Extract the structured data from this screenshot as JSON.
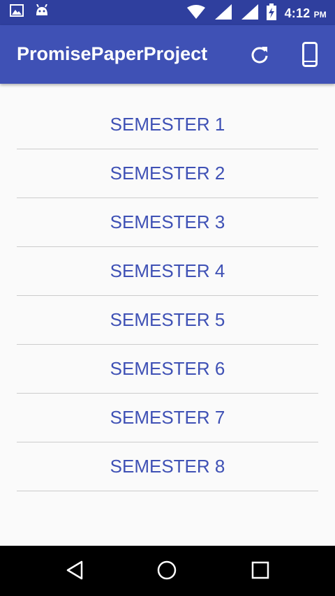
{
  "status_bar": {
    "time": "4:12",
    "ampm": "PM",
    "icons": [
      "image-icon",
      "android-icon",
      "wifi-icon",
      "signal-icon",
      "signal-icon",
      "battery-charging-icon"
    ]
  },
  "app_bar": {
    "title": "PromisePaperProject",
    "actions": [
      "refresh-icon",
      "phone-icon"
    ]
  },
  "semesters": [
    "SEMESTER 1",
    "SEMESTER 2",
    "SEMESTER 3",
    "SEMESTER 4",
    "SEMESTER 5",
    "SEMESTER 6",
    "SEMESTER 7",
    "SEMESTER 8"
  ],
  "nav_bar": {
    "buttons": [
      "back-icon",
      "home-icon",
      "recents-icon"
    ]
  },
  "colors": {
    "status_bar": "#2f3f9e",
    "app_bar": "#3f51b5",
    "accent_text": "#3f51b5",
    "background": "#fafafa"
  }
}
